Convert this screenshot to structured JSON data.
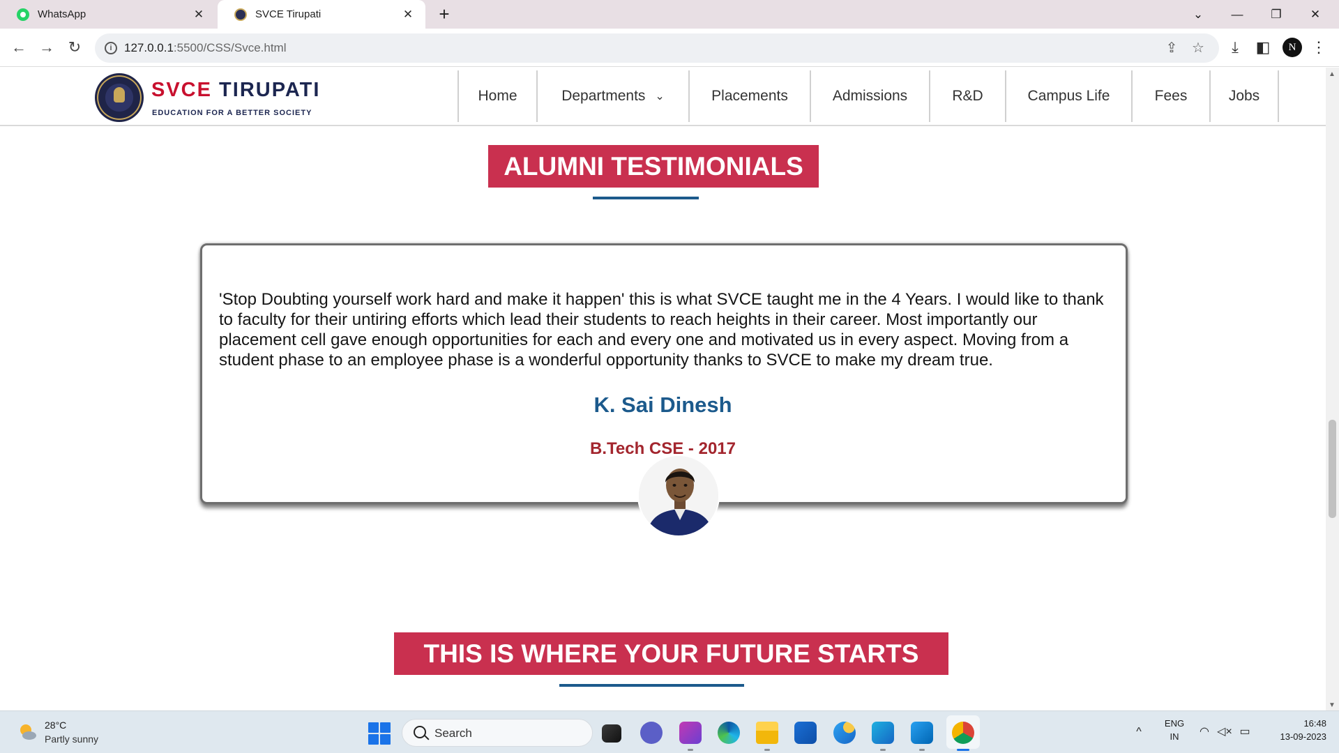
{
  "browser": {
    "tabs": [
      {
        "title": "WhatsApp",
        "icon": "whatsapp-favicon",
        "active": false
      },
      {
        "title": "SVCE Tirupati",
        "icon": "svce-favicon",
        "active": true
      }
    ],
    "url_host": "127.0.0.1",
    "url_path": ":5500/CSS/Svce.html",
    "profile_initial": "N"
  },
  "site": {
    "logo": {
      "title_red": "SVCE",
      "title_navy": "TIRUPATI",
      "tagline": "EDUCATION FOR A BETTER SOCIETY"
    },
    "nav": [
      {
        "label": "Home",
        "has_dropdown": false
      },
      {
        "label": "Departments",
        "has_dropdown": true
      },
      {
        "label": "Placements",
        "has_dropdown": false
      },
      {
        "label": "Admissions",
        "has_dropdown": false
      },
      {
        "label": "R&D",
        "has_dropdown": false
      },
      {
        "label": "Campus Life",
        "has_dropdown": false
      },
      {
        "label": "Fees",
        "has_dropdown": false
      },
      {
        "label": "Jobs",
        "has_dropdown": false
      }
    ],
    "testimonials_heading": "ALUMNI TESTIMONIALS",
    "testimonial": {
      "quote": "'Stop Doubting yourself work hard and make it happen' this is what SVCE taught me in the 4 Years. I would like to thank to faculty for their untiring efforts which lead their students to reach heights in their career. Most importantly our placement cell gave enough opportunities for each and every one and motivated us in every aspect. Moving from a student phase to an employee phase is a wonderful opportunity thanks to SVCE to make my dream true.",
      "name": "K. Sai Dinesh",
      "course": "B.Tech CSE - 2017"
    },
    "future_heading": "THIS IS WHERE YOUR FUTURE STARTS",
    "colors": {
      "accent_red": "#c9304f",
      "navy": "#1c5a8c",
      "maroon": "#a3262e"
    }
  },
  "taskbar": {
    "weather_temp": "28°C",
    "weather_desc": "Partly sunny",
    "search_placeholder": "Search",
    "lang_line1": "ENG",
    "lang_line2": "IN",
    "time": "16:48",
    "date": "13-09-2023"
  }
}
